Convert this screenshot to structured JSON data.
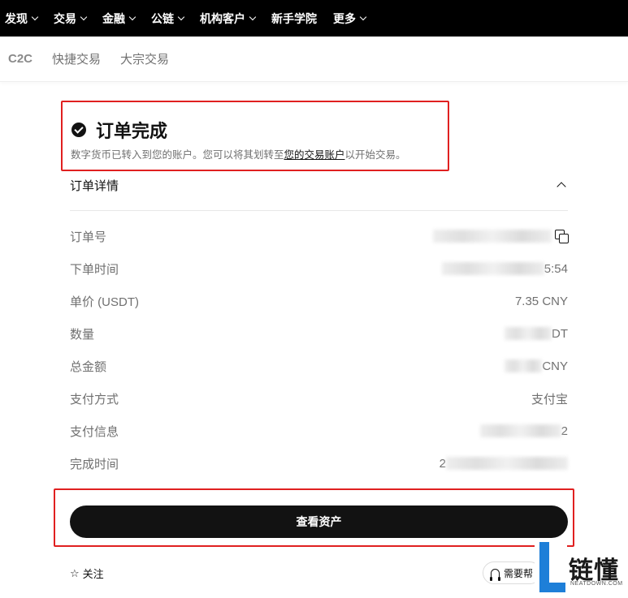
{
  "topnav": {
    "items": [
      {
        "label": "发现",
        "has_menu": true
      },
      {
        "label": "交易",
        "has_menu": true
      },
      {
        "label": "金融",
        "has_menu": true
      },
      {
        "label": "公链",
        "has_menu": true
      },
      {
        "label": "机构客户",
        "has_menu": true
      },
      {
        "label": "新手学院",
        "has_menu": false
      },
      {
        "label": "更多",
        "has_menu": true
      }
    ]
  },
  "subnav": {
    "items": [
      {
        "label": "C2C",
        "active": true
      },
      {
        "label": "快捷交易",
        "active": false
      },
      {
        "label": "大宗交易",
        "active": false
      }
    ]
  },
  "status": {
    "title": "订单完成",
    "desc_before": "数字货币已转入到您的账户。您可以将其划转至",
    "desc_link": "您的交易账户",
    "desc_after": "以开始交易。"
  },
  "details": {
    "title": "订单详情",
    "rows": [
      {
        "label": "订单号",
        "value": ""
      },
      {
        "label": "下单时间",
        "value": "5:54"
      },
      {
        "label": "单价 (USDT)",
        "value": "7.35 CNY"
      },
      {
        "label": "数量",
        "value": "DT"
      },
      {
        "label": "总金额",
        "value": "CNY"
      },
      {
        "label": "支付方式",
        "value": "支付宝"
      },
      {
        "label": "支付信息",
        "value": "2"
      },
      {
        "label": "完成时间",
        "value": "2"
      }
    ]
  },
  "actions": {
    "view_assets": "查看资产",
    "follow": "关注",
    "help": "需要帮"
  },
  "watermark": {
    "brand": "链懂",
    "domain": "NEATDOWN.COM"
  },
  "colors": {
    "highlight": "#e02020",
    "primary": "#121212",
    "muted": "#707070",
    "watermark_blue": "#1e7fd8"
  }
}
